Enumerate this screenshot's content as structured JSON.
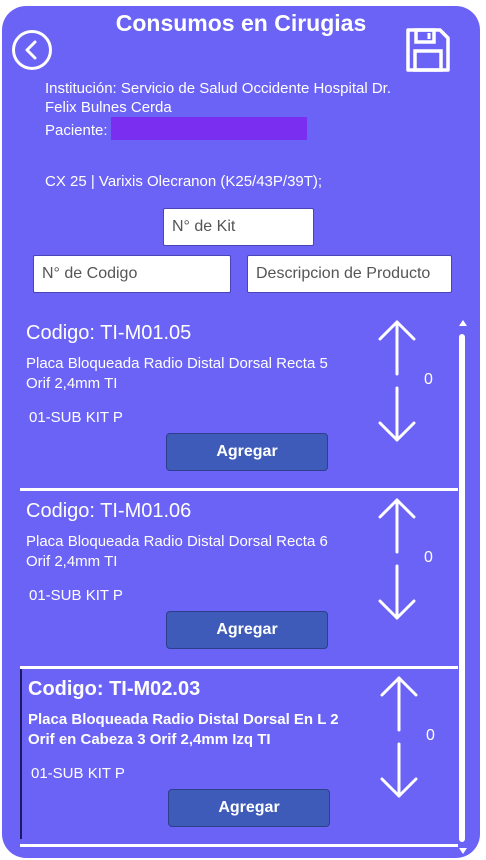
{
  "header": {
    "title": "Consumos en Cirugias",
    "back_icon": "chevron-left-icon",
    "save_icon": "floppy-disk-icon"
  },
  "info": {
    "institution_line1": "Institución: Servicio de Salud Occidente Hospital Dr.",
    "institution_line2": "Felix Bulnes Cerda",
    "patient_label": "Paciente:",
    "surgery": "CX 25 | Varixis Olecranon (K25/43P/39T);"
  },
  "filters": {
    "kit_placeholder": "N° de Kit",
    "code_placeholder": "N° de Codigo",
    "description_placeholder": "Descripcion de Producto"
  },
  "products": [
    {
      "code": "Codigo: TI-M01.05",
      "desc_line1": "Placa Bloqueada Radio Distal Dorsal Recta 5",
      "desc_line2": "Orif 2,4mm TI",
      "kit": "01-SUB KIT P",
      "qty": "0",
      "add_label": "Agregar"
    },
    {
      "code": "Codigo: TI-M01.06",
      "desc_line1": "Placa Bloqueada Radio Distal Dorsal Recta 6",
      "desc_line2": "Orif 2,4mm TI",
      "kit": "01-SUB KIT P",
      "qty": "0",
      "add_label": "Agregar"
    },
    {
      "code": "Codigo: TI-M02.03",
      "desc_line1": "Placa Bloqueada Radio Distal Dorsal En L 2",
      "desc_line2": "Orif en Cabeza 3 Orif 2,4mm Izq TI",
      "kit": "01-SUB KIT P",
      "qty": "0",
      "add_label": "Agregar"
    }
  ],
  "colors": {
    "background": "#6b63f5",
    "button": "#3e5bb9",
    "redaction": "#7a2ff0"
  }
}
